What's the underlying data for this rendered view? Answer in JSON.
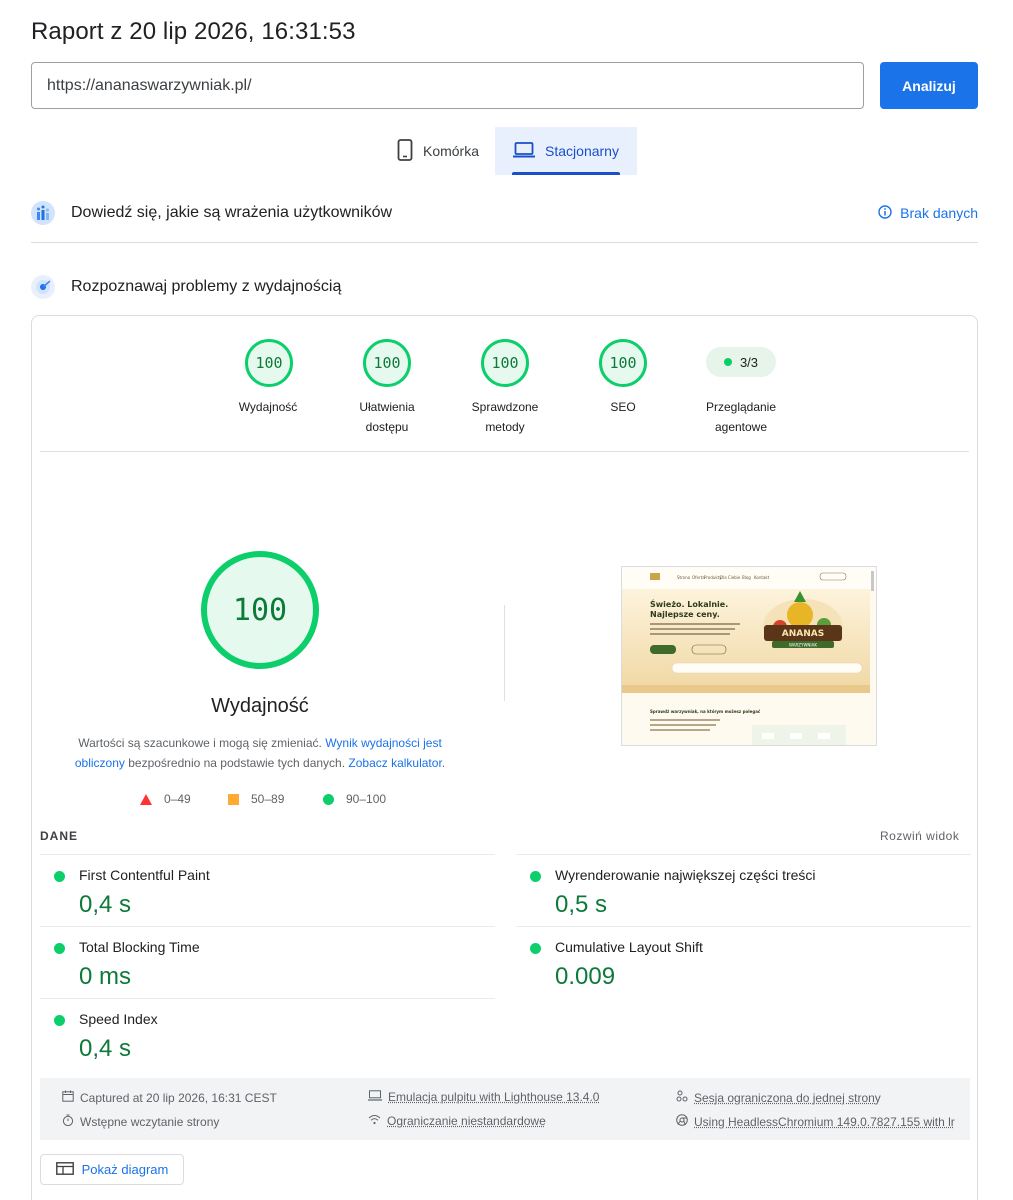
{
  "report_title": "Raport z 20 lip 2026, 16:31:53",
  "url_input": {
    "value": "https://ananaswarzywniak.pl/",
    "button": "Analizuj"
  },
  "tabs": {
    "mobile": "Komórka",
    "desktop": "Stacjonarny",
    "active": "desktop"
  },
  "crux_section": {
    "title": "Dowiedź się, jakie są wrażenia użytkowników",
    "status": "Brak danych"
  },
  "lab_section": {
    "title": "Rozpoznawaj problemy z wydajnością"
  },
  "category_scores": [
    {
      "label_line1": "Wydajność",
      "label_line2": "",
      "score": "100"
    },
    {
      "label_line1": "Ułatwienia",
      "label_line2": "dostępu",
      "score": "100"
    },
    {
      "label_line1": "Sprawdzone",
      "label_line2": "metody",
      "score": "100"
    },
    {
      "label_line1": "SEO",
      "label_line2": "",
      "score": "100"
    }
  ],
  "agentic": {
    "value": "3/3",
    "label_line1": "Przeglądanie",
    "label_line2": "agentowe"
  },
  "performance": {
    "score": "100",
    "title": "Wydajność",
    "desc_part1": "Wartości są szacunkowe i mogą się zmieniać. ",
    "desc_link1": "Wynik wydajności jest obliczony",
    "desc_part2": " bezpośrednio na podstawie tych danych. ",
    "desc_link2": "Zobacz kalkulator",
    "desc_part3": "."
  },
  "legend": {
    "fail": "0–49",
    "average": "50–89",
    "pass": "90–100"
  },
  "screenshot": {
    "nav": [
      "Strona",
      "Oferta",
      "Produkty",
      "Dla Ciebie",
      "Blog",
      "Kontakt"
    ],
    "hero_line1": "Świeżo. Lokalnie.",
    "hero_line2": "Najlepsze ceny.",
    "logo_text_1": "ANANAS",
    "logo_text_2": "WARZYWNIAK",
    "section_title": "Sprawdź warzywniak, na którym możesz polegać"
  },
  "metrics_header": {
    "label": "DANE",
    "expand": "Rozwiń widok"
  },
  "metrics": [
    {
      "name": "First Contentful Paint",
      "value": "0,4 s"
    },
    {
      "name": "Wyrenderowanie największej części treści",
      "value": "0,5 s"
    },
    {
      "name": "Total Blocking Time",
      "value": "0 ms"
    },
    {
      "name": "Cumulative Layout Shift",
      "value": "0.009"
    },
    {
      "name": "Speed Index",
      "value": "0,4 s"
    }
  ],
  "run_info": {
    "captured": "Captured at 20 lip 2026, 16:31 CEST",
    "initial_load": "Wstępne wczytanie strony",
    "emulation": "Emulacja pulpitu with Lighthouse 13.4.0",
    "throttling": "Ograniczanie niestandardowe",
    "session": "Sesja ograniczona do jednej strony",
    "browser": "Using HeadlessChromium 149.0.7827.155 with lr"
  },
  "show_diagram": "Pokaż diagram",
  "colors": {
    "pass": "#0cce6b",
    "average": "#ffaa33",
    "fail": "#ff3333",
    "accent": "#1a73e8"
  }
}
